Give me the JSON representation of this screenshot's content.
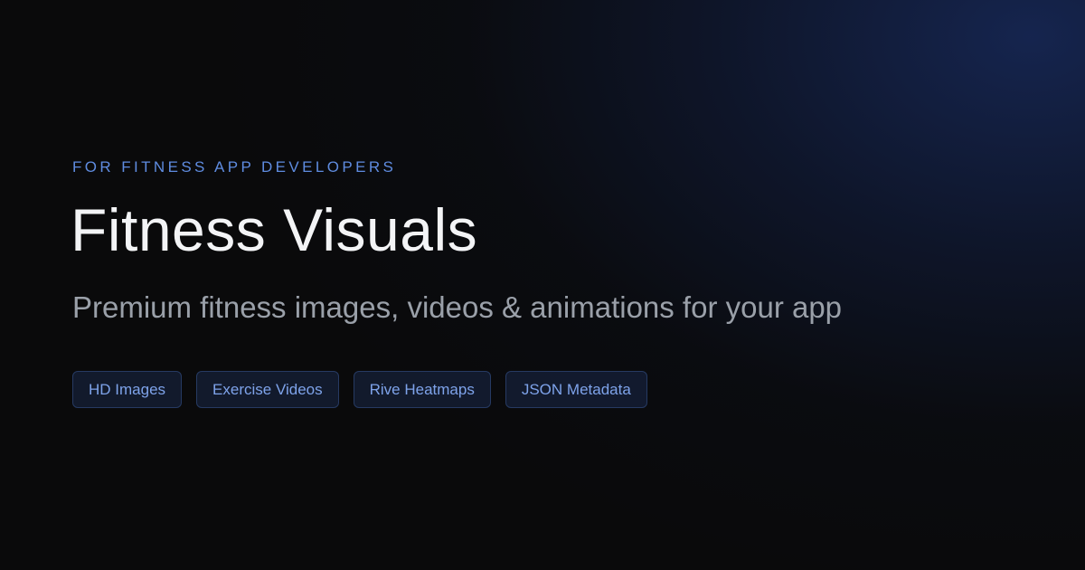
{
  "hero": {
    "eyebrow": "FOR FITNESS APP DEVELOPERS",
    "title": "Fitness Visuals",
    "subtitle": "Premium fitness images, videos & animations for your app"
  },
  "tags": [
    "HD Images",
    "Exercise Videos",
    "Rive Heatmaps",
    "JSON Metadata"
  ],
  "colors": {
    "background": "#0a0a0b",
    "glow": "#162652",
    "accent": "#5f8ce0",
    "title": "#f3f4f6",
    "subtitle": "#9aa0a9",
    "tag_text": "#7ea3ea",
    "tag_border": "#263a62"
  }
}
